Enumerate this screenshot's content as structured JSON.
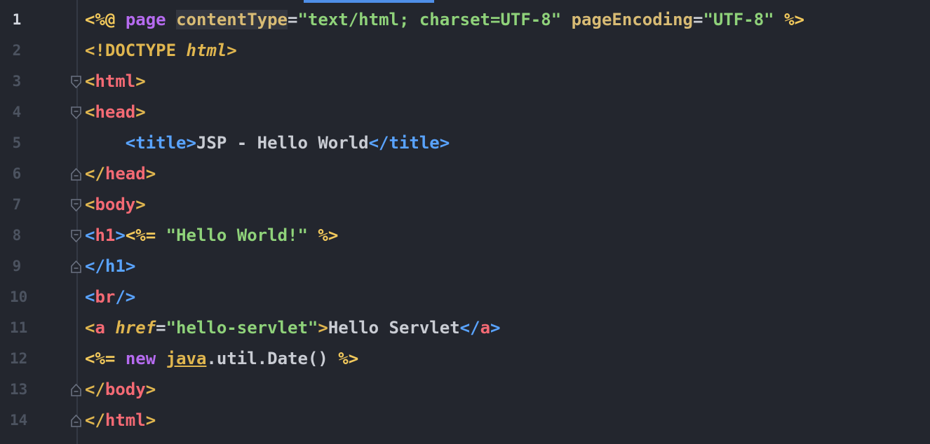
{
  "editor": {
    "active_line": 1,
    "lines": [
      {
        "num": "1",
        "segments": [
          {
            "t": "<%@",
            "c": "cmark"
          },
          {
            "t": " ",
            "c": "plain"
          },
          {
            "t": "page",
            "c": "kw"
          },
          {
            "t": " ",
            "c": "plain"
          },
          {
            "t": "contentType",
            "c": "attr hl"
          },
          {
            "t": "=",
            "c": "plain"
          },
          {
            "t": "\"text/html; charset=UTF-8\"",
            "c": "str"
          },
          {
            "t": " ",
            "c": "plain"
          },
          {
            "t": "pageEncoding",
            "c": "attr"
          },
          {
            "t": "=",
            "c": "plain"
          },
          {
            "t": "\"UTF-8\"",
            "c": "str"
          },
          {
            "t": " ",
            "c": "plain"
          },
          {
            "t": "%>",
            "c": "cmark"
          }
        ]
      },
      {
        "num": "2",
        "segments": [
          {
            "t": "<!DOCTYPE",
            "c": "dt"
          },
          {
            "t": " ",
            "c": "plain"
          },
          {
            "t": "html",
            "c": "it"
          },
          {
            "t": ">",
            "c": "dt"
          }
        ]
      },
      {
        "num": "3",
        "fold": "open",
        "segments": [
          {
            "t": "<",
            "c": "tagb"
          },
          {
            "t": "html",
            "c": "tagn"
          },
          {
            "t": ">",
            "c": "tagb"
          }
        ]
      },
      {
        "num": "4",
        "fold": "open",
        "segments": [
          {
            "t": "<",
            "c": "tagb"
          },
          {
            "t": "head",
            "c": "tagn"
          },
          {
            "t": ">",
            "c": "tagb"
          }
        ]
      },
      {
        "num": "5",
        "indent": 4,
        "segments": [
          {
            "t": "<",
            "c": "tagb2"
          },
          {
            "t": "title",
            "c": "tagn2"
          },
          {
            "t": ">",
            "c": "tagb2"
          },
          {
            "t": "JSP - Hello World",
            "c": "plain"
          },
          {
            "t": "</",
            "c": "tagb2"
          },
          {
            "t": "title",
            "c": "tagn2"
          },
          {
            "t": ">",
            "c": "tagb2"
          }
        ]
      },
      {
        "num": "6",
        "fold": "close",
        "segments": [
          {
            "t": "</",
            "c": "tagb"
          },
          {
            "t": "head",
            "c": "tagn"
          },
          {
            "t": ">",
            "c": "tagb"
          }
        ]
      },
      {
        "num": "7",
        "fold": "open",
        "segments": [
          {
            "t": "<",
            "c": "tagb"
          },
          {
            "t": "body",
            "c": "tagn"
          },
          {
            "t": ">",
            "c": "tagb"
          }
        ]
      },
      {
        "num": "8",
        "fold": "open",
        "segments": [
          {
            "t": "<",
            "c": "tagb2"
          },
          {
            "t": "h1",
            "c": "tagn"
          },
          {
            "t": ">",
            "c": "tagb2"
          },
          {
            "t": "<%=",
            "c": "cmark"
          },
          {
            "t": " ",
            "c": "plain"
          },
          {
            "t": "\"Hello World!\"",
            "c": "str"
          },
          {
            "t": " ",
            "c": "plain"
          },
          {
            "t": "%>",
            "c": "cmark"
          }
        ]
      },
      {
        "num": "9",
        "fold": "close",
        "segments": [
          {
            "t": "</",
            "c": "tagb2"
          },
          {
            "t": "h1",
            "c": "tagn2"
          },
          {
            "t": ">",
            "c": "tagb2"
          }
        ]
      },
      {
        "num": "10",
        "segments": [
          {
            "t": "<",
            "c": "tagb2"
          },
          {
            "t": "br",
            "c": "tagn"
          },
          {
            "t": "/>",
            "c": "tagb2"
          }
        ]
      },
      {
        "num": "11",
        "segments": [
          {
            "t": "<",
            "c": "tagb"
          },
          {
            "t": "a",
            "c": "tagn"
          },
          {
            "t": " ",
            "c": "plain"
          },
          {
            "t": "href",
            "c": "it"
          },
          {
            "t": "=",
            "c": "plain"
          },
          {
            "t": "\"hello-servlet\"",
            "c": "str"
          },
          {
            "t": ">",
            "c": "tagb"
          },
          {
            "t": "Hello Servlet",
            "c": "plain"
          },
          {
            "t": "</",
            "c": "tagb2"
          },
          {
            "t": "a",
            "c": "tagn"
          },
          {
            "t": ">",
            "c": "tagb2"
          }
        ]
      },
      {
        "num": "12",
        "segments": [
          {
            "t": "<%=",
            "c": "cmark"
          },
          {
            "t": " ",
            "c": "plain"
          },
          {
            "t": "new",
            "c": "kw"
          },
          {
            "t": " ",
            "c": "plain"
          },
          {
            "t": "java",
            "c": "under"
          },
          {
            "t": ".util.Date() ",
            "c": "plain"
          },
          {
            "t": "%>",
            "c": "cmark"
          }
        ]
      },
      {
        "num": "13",
        "fold": "close",
        "segments": [
          {
            "t": "</",
            "c": "tagb"
          },
          {
            "t": "body",
            "c": "tagn"
          },
          {
            "t": ">",
            "c": "tagb"
          }
        ]
      },
      {
        "num": "14",
        "fold": "close",
        "segments": [
          {
            "t": "</",
            "c": "tagb"
          },
          {
            "t": "html",
            "c": "tagn"
          },
          {
            "t": ">",
            "c": "tagb"
          }
        ]
      }
    ]
  }
}
